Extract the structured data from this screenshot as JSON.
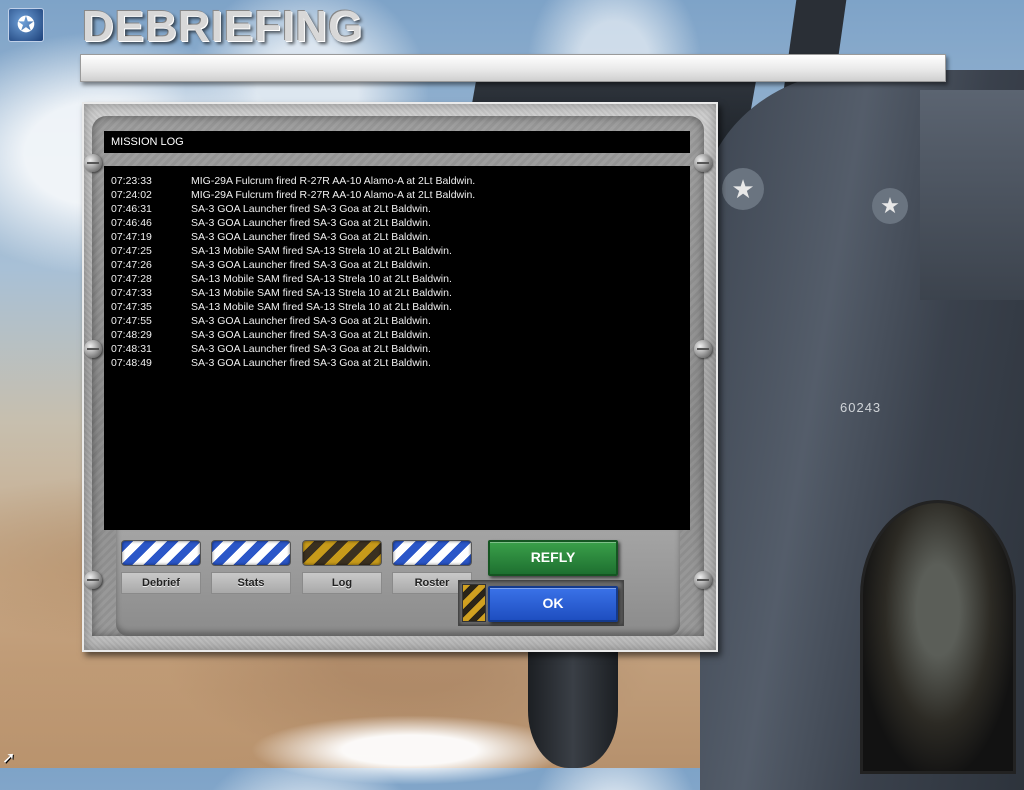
{
  "header": {
    "title": "DEBRIEFING",
    "logo_icon": "star-globe-icon"
  },
  "mission_log": {
    "heading": "MISSION LOG",
    "entries": [
      {
        "time": "07:23:33",
        "message": "MIG-29A Fulcrum fired R-27R  AA-10 Alamo-A at 2Lt Baldwin."
      },
      {
        "time": "07:24:02",
        "message": "MIG-29A Fulcrum fired R-27R  AA-10 Alamo-A at 2Lt Baldwin."
      },
      {
        "time": "07:46:31",
        "message": "SA-3 GOA Launcher fired SA-3 Goa at 2Lt Baldwin."
      },
      {
        "time": "07:46:46",
        "message": "SA-3 GOA Launcher fired SA-3 Goa at 2Lt Baldwin."
      },
      {
        "time": "07:47:19",
        "message": "SA-3 GOA Launcher fired SA-3 Goa at 2Lt Baldwin."
      },
      {
        "time": "07:47:25",
        "message": "SA-13 Mobile SAM fired SA-13 Strela 10 at 2Lt Baldwin."
      },
      {
        "time": "07:47:26",
        "message": "SA-3 GOA Launcher fired SA-3 Goa at 2Lt Baldwin."
      },
      {
        "time": "07:47:28",
        "message": "SA-13 Mobile SAM fired SA-13 Strela 10 at 2Lt Baldwin."
      },
      {
        "time": "07:47:33",
        "message": "SA-13 Mobile SAM fired SA-13 Strela 10 at 2Lt Baldwin."
      },
      {
        "time": "07:47:35",
        "message": "SA-13 Mobile SAM fired SA-13 Strela 10 at 2Lt Baldwin."
      },
      {
        "time": "07:47:55",
        "message": "SA-3 GOA Launcher fired SA-3 Goa at 2Lt Baldwin."
      },
      {
        "time": "07:48:29",
        "message": "SA-3 GOA Launcher fired SA-3 Goa at 2Lt Baldwin."
      },
      {
        "time": "07:48:31",
        "message": "SA-3 GOA Launcher fired SA-3 Goa at 2Lt Baldwin."
      },
      {
        "time": "07:48:49",
        "message": "SA-3 GOA Launcher fired SA-3 Goa at 2Lt Baldwin."
      }
    ]
  },
  "tabs": [
    {
      "label": "Debrief",
      "active": false
    },
    {
      "label": "Stats",
      "active": false
    },
    {
      "label": "Log",
      "active": true
    },
    {
      "label": "Roster",
      "active": false
    }
  ],
  "buttons": {
    "refly": "REFLY",
    "ok": "OK"
  },
  "background": {
    "tail_number": "60243"
  },
  "colors": {
    "tab_inactive_stripe": "#2a56c8",
    "tab_active_stripe": "#c79a1a",
    "refly_button": "#2e8a3e",
    "ok_button": "#2a5fd8",
    "log_background": "#000000"
  }
}
